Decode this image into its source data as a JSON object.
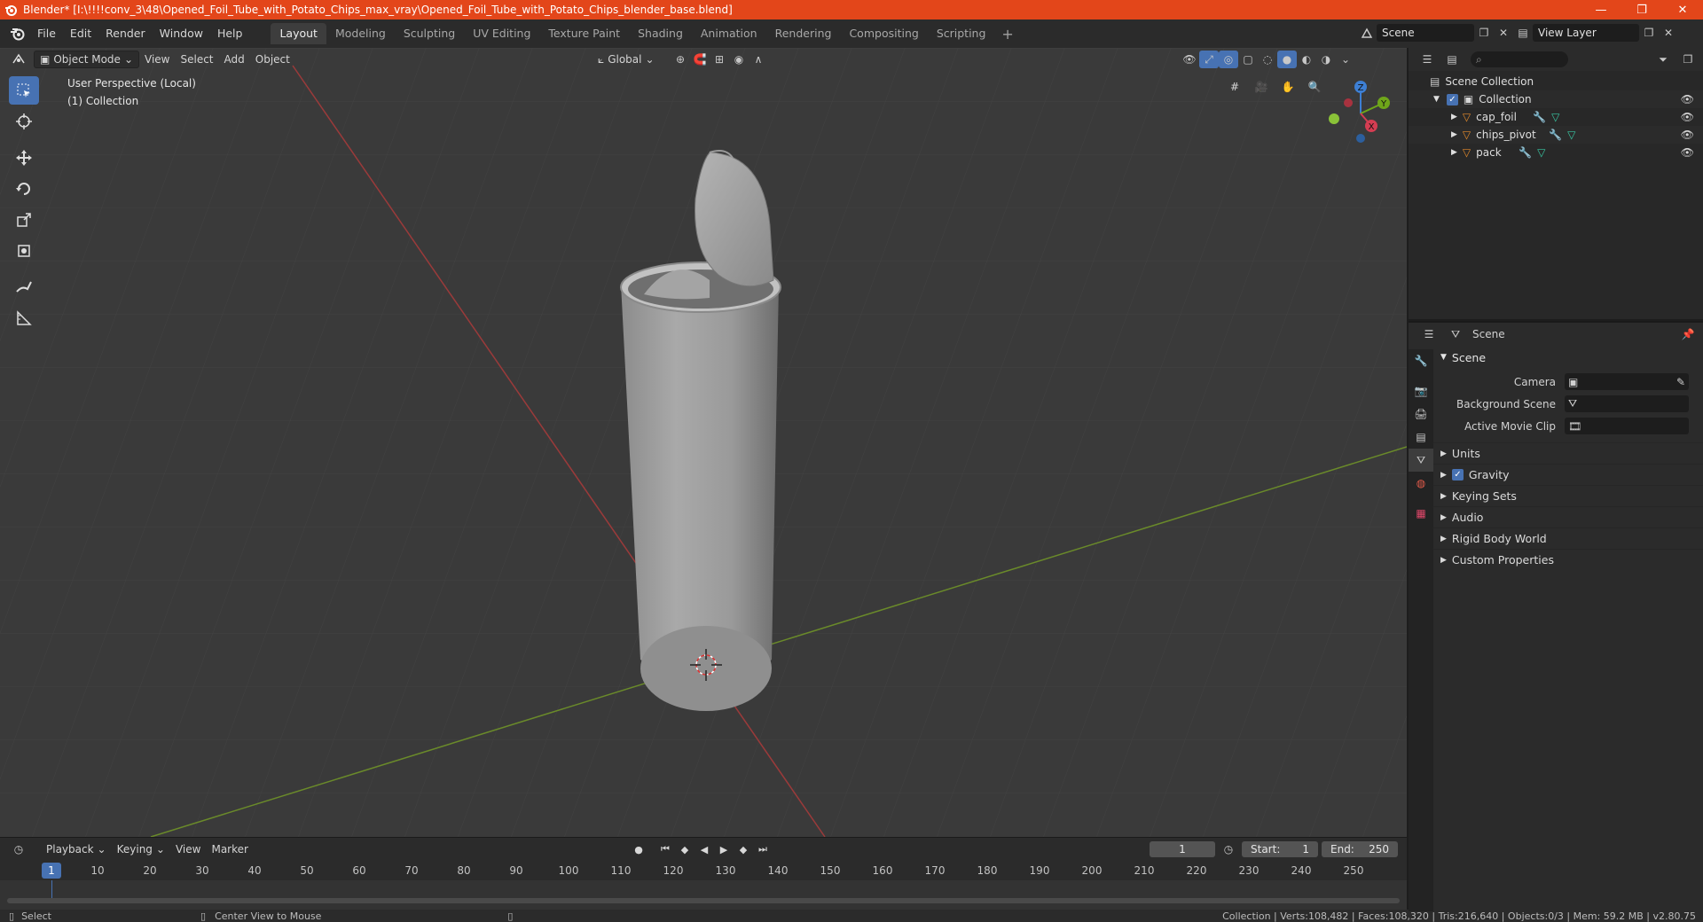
{
  "window": {
    "title": "Blender* [I:\\!!!!conv_3\\48\\Opened_Foil_Tube_with_Potato_Chips_max_vray\\Opened_Foil_Tube_with_Potato_Chips_blender_base.blend]",
    "minimize": "—",
    "maximize": "❐",
    "close": "✕"
  },
  "menu": [
    "File",
    "Edit",
    "Render",
    "Window",
    "Help"
  ],
  "workspaces": [
    "Layout",
    "Modeling",
    "Sculpting",
    "UV Editing",
    "Texture Paint",
    "Shading",
    "Animation",
    "Rendering",
    "Compositing",
    "Scripting"
  ],
  "active_workspace": "Layout",
  "scene_selector": {
    "scene": "Scene",
    "view_layer": "View Layer"
  },
  "viewport": {
    "mode": "Object Mode",
    "menus": [
      "View",
      "Select",
      "Add",
      "Object"
    ],
    "transform_orientation": "Global",
    "info_line1": "User Perspective (Local)",
    "info_line2": "(1) Collection",
    "gizmo_axes": {
      "z": "Z",
      "y": "Y",
      "x": "X"
    }
  },
  "timeline": {
    "menus": [
      "Playback",
      "Keying",
      "View",
      "Marker"
    ],
    "current_frame": "1",
    "start_label": "Start:",
    "start": "1",
    "end_label": "End:",
    "end": "250",
    "ticks": [
      "10",
      "20",
      "30",
      "40",
      "50",
      "60",
      "70",
      "80",
      "90",
      "100",
      "110",
      "120",
      "130",
      "140",
      "150",
      "160",
      "170",
      "180",
      "190",
      "200",
      "210",
      "220",
      "230",
      "240",
      "250"
    ]
  },
  "statusbar": {
    "left_action": "Select",
    "middle_action": "Center View to Mouse",
    "stats": "Collection | Verts:108,482 | Faces:108,320 | Tris:216,640 | Objects:0/3 | Mem: 59.2 MB | v2.80.75"
  },
  "outliner": {
    "root": "Scene Collection",
    "collection": "Collection",
    "objects": [
      "cap_foil",
      "chips_pivot",
      "pack"
    ]
  },
  "properties": {
    "header": "Scene",
    "panel": "Scene",
    "rows": [
      {
        "label": "Camera"
      },
      {
        "label": "Background Scene"
      },
      {
        "label": "Active Movie Clip"
      }
    ],
    "subpanels": [
      "Units",
      "Gravity",
      "Keying Sets",
      "Audio",
      "Rigid Body World",
      "Custom Properties"
    ]
  }
}
